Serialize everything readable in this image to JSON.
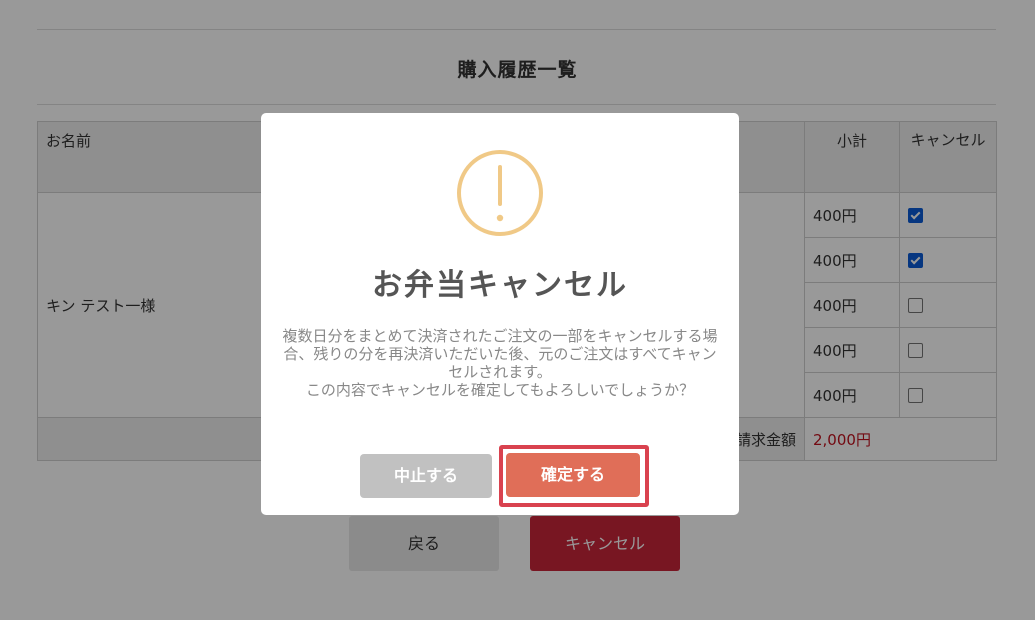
{
  "page": {
    "title": "購入履歴一覧"
  },
  "table": {
    "headers": {
      "name": "お名前",
      "subtotal": "小計",
      "cancel": "キャンセル"
    },
    "customer": "キン テスト一様",
    "rows": [
      {
        "price": "400円",
        "checked": true
      },
      {
        "price": "400円",
        "checked": true
      },
      {
        "price": "400円",
        "checked": false
      },
      {
        "price": "400円",
        "checked": false
      },
      {
        "price": "400円",
        "checked": false
      }
    ],
    "total_label": "請求金額",
    "total_value": "2,000円"
  },
  "buttons": {
    "back": "戻る",
    "cancel": "キャンセル"
  },
  "modal": {
    "title": "お弁当キャンセル",
    "text_line1": "複数日分をまとめて決済されたご注文の一部をキャンセルする場合、残りの分を再決済いただいた後、元のご注文はすべてキャンセルされます。",
    "text_line2": "この内容でキャンセルを確定してもよろしいでしょうか？",
    "abort_label": "中止する",
    "confirm_label": "確定する"
  },
  "colors": {
    "warning_icon": "#f0c987",
    "confirm_button": "#e06e58",
    "abort_button": "#c1c1c1",
    "highlight_outline": "#d9424f",
    "total_value": "#c0121e"
  }
}
